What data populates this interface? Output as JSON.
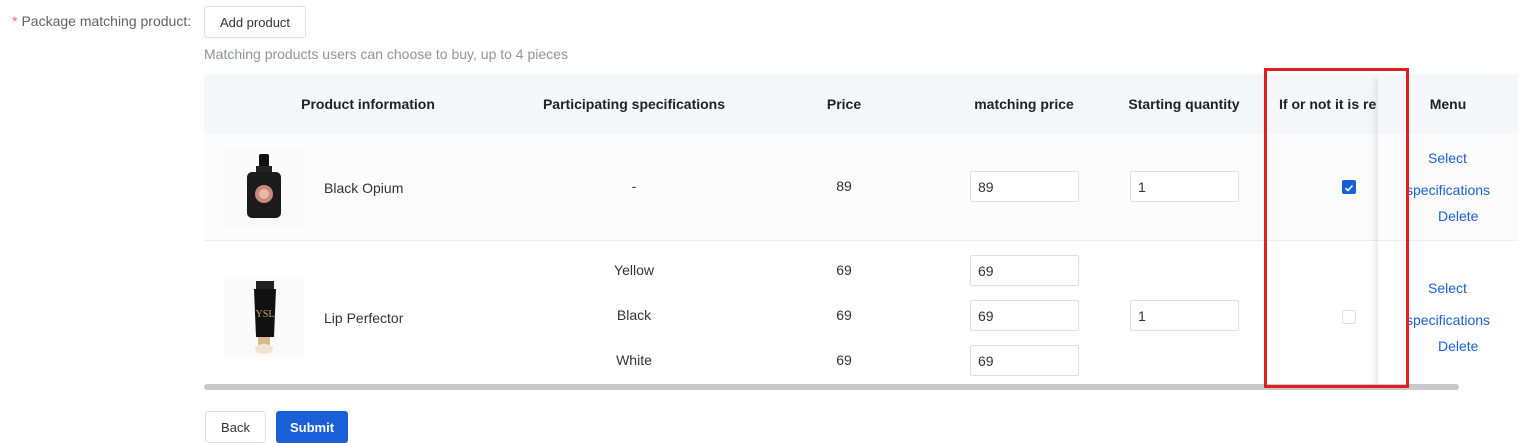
{
  "form": {
    "required_mark": "*",
    "label": "Package matching product:",
    "add_button": "Add product",
    "hint": "Matching products users can choose to buy, up to 4 pieces"
  },
  "table": {
    "columns": [
      "Product information",
      "Participating specifications",
      "Price",
      "matching price",
      "Starting quantity",
      "If or not it is re",
      "Menu"
    ],
    "rows": [
      {
        "name": "Black Opium",
        "image_icon": "perfume-bottle-icon",
        "specs": [
          {
            "spec": "-",
            "price": "89",
            "matching_price": "89"
          }
        ],
        "starting_quantity": "1",
        "required_checked": true,
        "menu": {
          "select": "Select",
          "specifications": "specifications",
          "delete": "Delete"
        }
      },
      {
        "name": "Lip Perfector",
        "image_icon": "lip-tube-icon",
        "specs": [
          {
            "spec": "Yellow",
            "price": "69",
            "matching_price": "69"
          },
          {
            "spec": "Black",
            "price": "69",
            "matching_price": "69"
          },
          {
            "spec": "White",
            "price": "69",
            "matching_price": "69"
          }
        ],
        "starting_quantity": "1",
        "required_checked": false,
        "menu": {
          "select": "Select",
          "specifications": "specifications",
          "delete": "Delete"
        }
      }
    ]
  },
  "footer": {
    "back_button": "Back",
    "submit_button": "Submit"
  },
  "colors": {
    "accent": "#1a5fd7",
    "highlight_box": "#e02020",
    "required": "#f56c6c"
  }
}
